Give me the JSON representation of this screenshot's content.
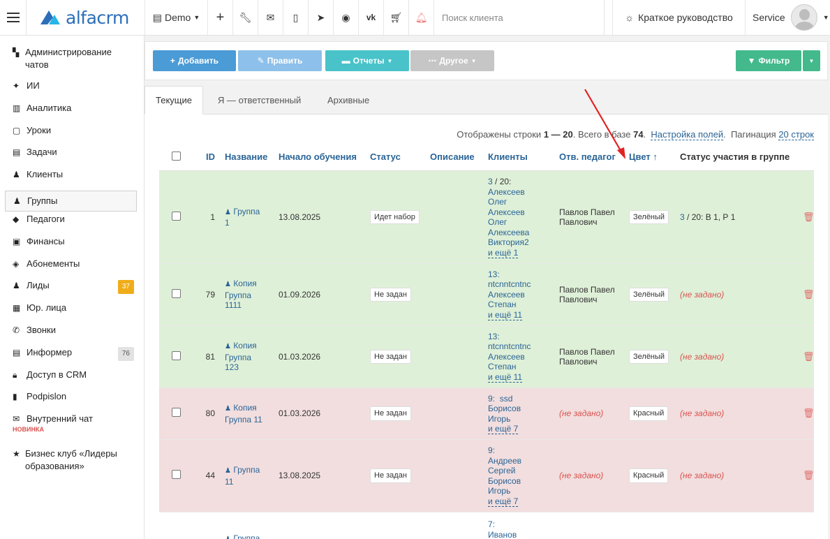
{
  "topbar": {
    "logo_text": "alfacrm",
    "branch": "Demo",
    "search_placeholder": "Поиск клиента",
    "guide": "Краткое руководство",
    "user": "Service",
    "icons": [
      "plus-icon",
      "wrench-icon",
      "envelope-icon",
      "mobile-icon",
      "telegram-icon",
      "whatsapp-icon",
      "vk-icon",
      "cart-icon",
      "bell-icon"
    ]
  },
  "sidebar": {
    "items": [
      {
        "label": "Администрирование чатов",
        "icon": "chats-icon"
      },
      {
        "label": "ИИ",
        "icon": "sparkle-icon"
      },
      {
        "label": "Аналитика",
        "icon": "map-icon"
      },
      {
        "label": "Уроки",
        "icon": "calendar-icon"
      },
      {
        "label": "Задачи",
        "icon": "clipboard-icon"
      },
      {
        "label": "Клиенты",
        "icon": "user-icon"
      },
      {
        "label": "Группы",
        "icon": "users-icon"
      },
      {
        "label": "Педагоги",
        "icon": "graduation-icon"
      },
      {
        "label": "Финансы",
        "icon": "money-icon"
      },
      {
        "label": "Абонементы",
        "icon": "tag-icon"
      },
      {
        "label": "Лиды",
        "icon": "user-plus-icon",
        "badge": "37"
      },
      {
        "label": "Юр. лица",
        "icon": "briefcase-icon"
      },
      {
        "label": "Звонки",
        "icon": "phone-icon"
      },
      {
        "label": "Информер",
        "icon": "list-icon",
        "badge": "76"
      },
      {
        "label": "Доступ в CRM",
        "icon": "lock-icon"
      },
      {
        "label": "Podpislon",
        "icon": "file-icon"
      },
      {
        "label": "Внутренний чат",
        "icon": "mail-icon",
        "tag": "НОВИНКА"
      },
      {
        "label": "Бизнес клуб «Лидеры образования»",
        "icon": "star-icon"
      }
    ]
  },
  "toolbar": {
    "add": "Добавить",
    "edit": "Править",
    "reports": "Отчеты",
    "other": "Другое",
    "filter": "Фильтр"
  },
  "tabs": [
    "Текущие",
    "Я — ответственный",
    "Архивные"
  ],
  "meta": {
    "prefix": "Отображены строки",
    "range": "1 — 20",
    "total_label": ". Всего в базе",
    "total": "74",
    "dot": ".",
    "fields_link": "Настройка полей",
    "pagination_label": "Пагинация",
    "pagination_link": "20 строк"
  },
  "table": {
    "headers": {
      "id": "ID",
      "name": "Название",
      "start": "Начало обучения",
      "status": "Статус",
      "desc": "Описание",
      "clients": "Клиенты",
      "teacher": "Отв. педагог",
      "color": "Цвет ↑",
      "participation": "Статус участия в группе"
    },
    "rows": [
      {
        "id": "1",
        "name": [
          "Группа",
          "1"
        ],
        "start": "13.08.2025",
        "status": "Идет набор",
        "clients": {
          "count": "3",
          "suffix": "/ 20:",
          "names": [
            "Алексеев",
            "Олег",
            "Алексеев",
            "Олег",
            "Алексеева",
            "Виктория2"
          ],
          "more": "и ещё 1"
        },
        "teacher": [
          "Павлов Павел",
          "Павлович"
        ],
        "color": "Зелёный",
        "participation": {
          "count": "3",
          "text": "/ 20:  В 1, Р 1"
        }
      },
      {
        "id": "79",
        "name": [
          "Копия",
          "Группа",
          "1111"
        ],
        "start": "01.09.2026",
        "status": "Не задан",
        "clients": {
          "count": "13:",
          "suffix": "",
          "names": [
            "ntcnntcntnc",
            "Алексеев",
            "Степан"
          ],
          "more": "и ещё 11"
        },
        "teacher": [
          "Павлов Павел",
          "Павлович"
        ],
        "color": "Зелёный",
        "participation": {
          "empty": "(не задано)"
        }
      },
      {
        "id": "81",
        "name": [
          "Копия",
          "Группа",
          "123"
        ],
        "start": "01.03.2026",
        "status": "Не задан",
        "clients": {
          "count": "13:",
          "suffix": "",
          "names": [
            "ntcnntcntnc",
            "Алексеев",
            "Степан"
          ],
          "more": "и ещё 11"
        },
        "teacher": [
          "Павлов Павел",
          "Павлович"
        ],
        "color": "Зелёный",
        "participation": {
          "empty": "(не задано)"
        }
      },
      {
        "id": "80",
        "name": [
          "Копия",
          "Группа 11"
        ],
        "start": "01.03.2026",
        "status": "Не задан",
        "clients": {
          "count": "9:",
          "suffix": "ssd",
          "names": [
            "Борисов",
            "Игорь"
          ],
          "more": "и ещё 7"
        },
        "teacher_empty": "(не задано)",
        "color": "Красный",
        "participation": {
          "empty": "(не задано)"
        }
      },
      {
        "id": "44",
        "name": [
          "Группа",
          "11"
        ],
        "start": "13.08.2025",
        "status": "Не задан",
        "clients": {
          "count": "9:",
          "suffix": "",
          "names": [
            "Андреев",
            "Сергей",
            "Борисов",
            "Игорь"
          ],
          "more": "и ещё 7"
        },
        "teacher_empty": "(не задано)",
        "color": "Красный",
        "participation": {
          "empty": "(не задано)"
        }
      },
      {
        "name": [
          "Группа"
        ],
        "clients": {
          "count": "7:",
          "names": [
            "Иванов"
          ]
        }
      }
    ]
  },
  "colors": {
    "row_green": "#dff0d8",
    "row_red": "#f2dede",
    "accent_blue": "#4a9bd6",
    "arrow_red": "#e32222"
  }
}
